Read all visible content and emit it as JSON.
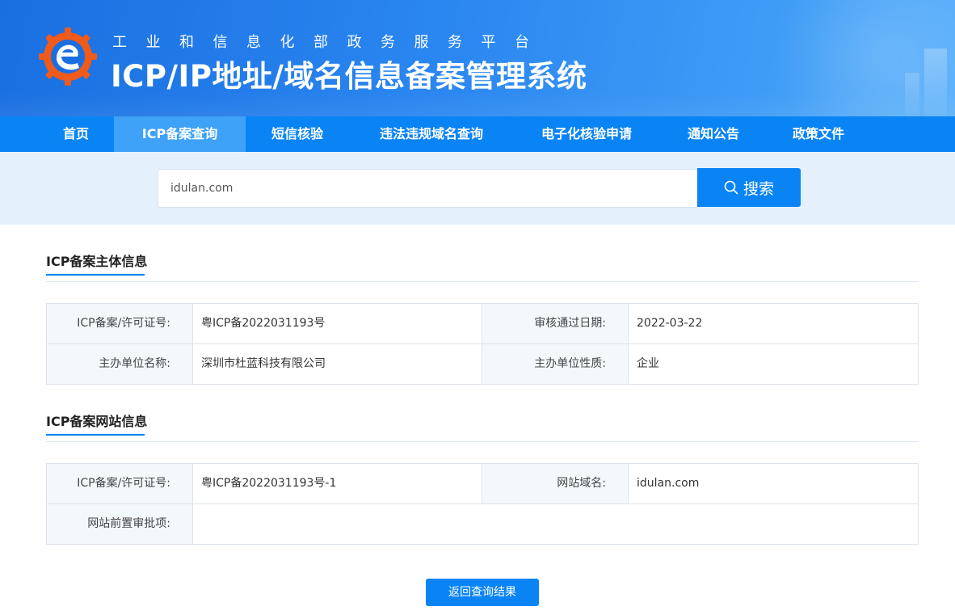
{
  "header": {
    "subtitle": "工业和信息化部政务服务平台",
    "title": "ICP/IP地址/域名信息备案管理系统"
  },
  "nav": {
    "items": [
      {
        "label": "首页"
      },
      {
        "label": "ICP备案查询",
        "active": true
      },
      {
        "label": "短信核验"
      },
      {
        "label": "违法违规域名查询"
      },
      {
        "label": "电子化核验申请"
      },
      {
        "label": "通知公告"
      },
      {
        "label": "政策文件"
      }
    ]
  },
  "search": {
    "value": "idulan.com",
    "button_label": "搜索",
    "icon": "search-icon"
  },
  "subject_info": {
    "title": "ICP备案主体信息",
    "rows": [
      {
        "label1": "ICP备案/许可证号:",
        "value1": "粤ICP备2022031193号",
        "label2": "审核通过日期:",
        "value2": "2022-03-22"
      },
      {
        "label1": "主办单位名称:",
        "value1": "深圳市杜蓝科技有限公司",
        "label2": "主办单位性质:",
        "value2": "企业"
      }
    ]
  },
  "website_info": {
    "title": "ICP备案网站信息",
    "rows": [
      {
        "label1": "ICP备案/许可证号:",
        "value1": "粤ICP备2022031193号-1",
        "label2": "网站域名:",
        "value2": "idulan.com"
      },
      {
        "label1": "网站前置审批项:",
        "value1": ""
      }
    ]
  },
  "back_button_label": "返回查询结果",
  "colors": {
    "primary": "#0a84f5",
    "nav_active": "#3ea2f8",
    "search_band": "#e4f1fd",
    "label_bg": "#f3f8fd"
  }
}
